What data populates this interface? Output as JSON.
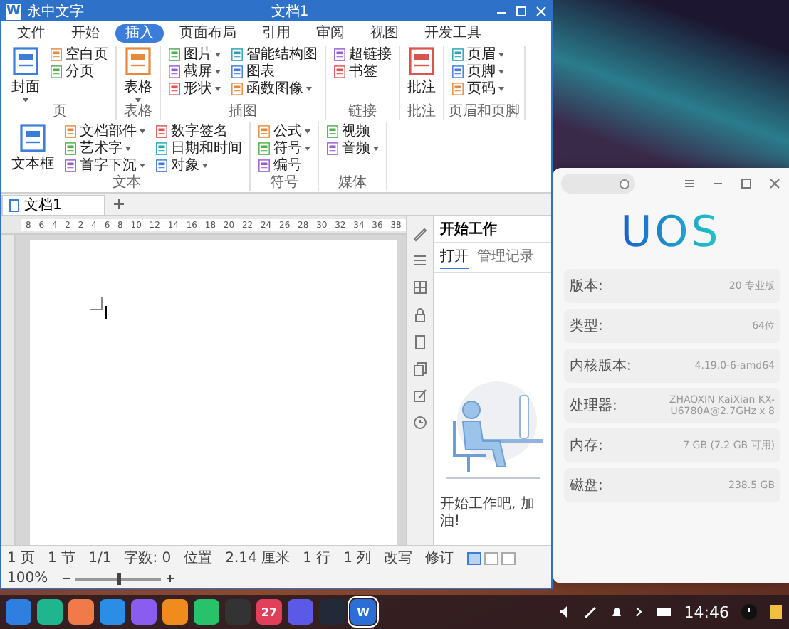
{
  "word_window": {
    "logo": "W",
    "app_title": "永中文字",
    "doc_title": "文档1",
    "menu_tabs": [
      {
        "label": "文件",
        "selected": false
      },
      {
        "label": "开始",
        "selected": false
      },
      {
        "label": "插入",
        "selected": true
      },
      {
        "label": "页面布局",
        "selected": false
      },
      {
        "label": "引用",
        "selected": false
      },
      {
        "label": "审阅",
        "selected": false
      },
      {
        "label": "视图",
        "selected": false
      },
      {
        "label": "开发工具",
        "selected": false
      }
    ],
    "ribbon_groups": [
      {
        "name": "页",
        "items": [
          {
            "label": "封面",
            "kind": "large",
            "dropdown": true
          },
          {
            "label": "空白页",
            "kind": "small",
            "dropdown": false
          },
          {
            "label": "分页",
            "kind": "small",
            "dropdown": false
          }
        ]
      },
      {
        "name": "表格",
        "items": [
          {
            "label": "表格",
            "kind": "large",
            "dropdown": true
          }
        ]
      },
      {
        "name": "插图",
        "items": [
          {
            "label": "图片",
            "kind": "small",
            "dropdown": true
          },
          {
            "label": "截屏",
            "kind": "small",
            "dropdown": true
          },
          {
            "label": "形状",
            "kind": "small",
            "dropdown": true
          },
          {
            "label": "智能结构图",
            "kind": "small",
            "dropdown": false
          },
          {
            "label": "图表",
            "kind": "small",
            "dropdown": false
          },
          {
            "label": "函数图像",
            "kind": "small",
            "dropdown": true
          }
        ]
      },
      {
        "name": "链接",
        "items": [
          {
            "label": "超链接",
            "kind": "small",
            "dropdown": false
          },
          {
            "label": "书签",
            "kind": "small",
            "dropdown": false
          }
        ]
      },
      {
        "name": "批注",
        "items": [
          {
            "label": "批注",
            "kind": "large",
            "dropdown": false
          }
        ]
      },
      {
        "name": "页眉和页脚",
        "items": [
          {
            "label": "页眉",
            "kind": "small",
            "dropdown": true
          },
          {
            "label": "页脚",
            "kind": "small",
            "dropdown": true
          },
          {
            "label": "页码",
            "kind": "small",
            "dropdown": true
          }
        ]
      },
      {
        "name": "文本",
        "items": [
          {
            "label": "文本框",
            "kind": "large",
            "dropdown": false
          },
          {
            "label": "文档部件",
            "kind": "small",
            "dropdown": true
          },
          {
            "label": "艺术字",
            "kind": "small",
            "dropdown": true
          },
          {
            "label": "首字下沉",
            "kind": "small",
            "dropdown": true
          },
          {
            "label": "数字签名",
            "kind": "small",
            "dropdown": false
          },
          {
            "label": "日期和时间",
            "kind": "small",
            "dropdown": false
          },
          {
            "label": "对象",
            "kind": "small",
            "dropdown": true
          }
        ]
      },
      {
        "name": "符号",
        "items": [
          {
            "label": "公式",
            "kind": "small",
            "dropdown": true
          },
          {
            "label": "符号",
            "kind": "small",
            "dropdown": true
          },
          {
            "label": "编号",
            "kind": "small",
            "dropdown": false
          }
        ]
      },
      {
        "name": "媒体",
        "items": [
          {
            "label": "视频",
            "kind": "small",
            "dropdown": false
          },
          {
            "label": "音频",
            "kind": "small",
            "dropdown": true
          }
        ]
      }
    ],
    "doc_tab": "文档1",
    "ruler": [
      "8",
      "6",
      "4",
      "2",
      "2",
      "4",
      "6",
      "8",
      "10",
      "12",
      "14",
      "16",
      "18",
      "20",
      "22",
      "24",
      "26",
      "28",
      "30",
      "32",
      "34",
      "36",
      "38"
    ],
    "side_panel": {
      "title": "开始工作",
      "tabs": [
        {
          "label": "打开",
          "selected": true
        },
        {
          "label": "管理记录",
          "selected": false
        }
      ],
      "message": "开始工作吧, 加油!"
    },
    "status_bar": [
      "1 页",
      "1 节",
      "1/1",
      "字数: 0",
      "位置",
      "2.14 厘米",
      "1 行",
      "1 列",
      "改写",
      "修订"
    ],
    "view_buttons": [
      {
        "selected": true
      },
      {
        "selected": false
      },
      {
        "selected": false
      }
    ],
    "zoom": {
      "text": "100%",
      "level": 0.5
    }
  },
  "about_window": {
    "logo": "UOS",
    "rows": [
      {
        "label": "版本:",
        "value": "20 专业版"
      },
      {
        "label": "类型:",
        "value": "64位"
      },
      {
        "label": "内核版本:",
        "value": "4.19.0-6-amd64"
      },
      {
        "label": "处理器:",
        "value": "ZHAOXIN KaiXian KX-U6780A@2.7GHz x 8"
      },
      {
        "label": "内存:",
        "value": "7 GB (7.2 GB 可用)"
      },
      {
        "label": "磁盘:",
        "value": "238.5 GB"
      }
    ]
  },
  "taskbar": {
    "apps": [
      {
        "color": "#2f7fe0",
        "active": false
      },
      {
        "color": "#1fb58f",
        "active": false
      },
      {
        "color": "#f07a4a",
        "active": false
      },
      {
        "color": "#2a8ee6",
        "active": false
      },
      {
        "color": "#8a5cf0",
        "active": false
      },
      {
        "color": "#f08c1e",
        "active": false
      },
      {
        "color": "#27c26a",
        "active": false
      },
      {
        "color": "#333333",
        "active": false
      },
      {
        "color": "#e0405a",
        "active": false,
        "label": "27"
      },
      {
        "color": "#5a5ae6",
        "active": false
      },
      {
        "color": "#222a3a",
        "active": false
      },
      {
        "color": "#2b6fd6",
        "active": true,
        "label": "W"
      }
    ],
    "clock": "14:46"
  }
}
